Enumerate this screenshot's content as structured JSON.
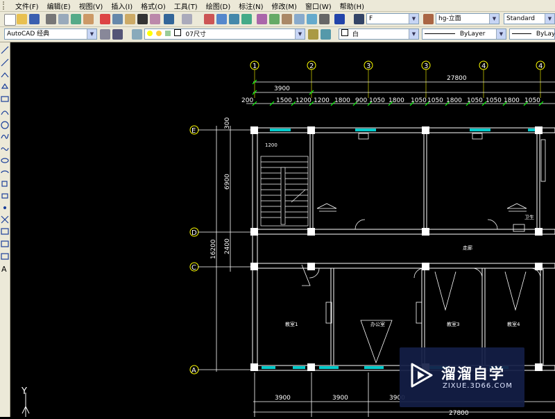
{
  "menu": [
    "文件(F)",
    "编辑(E)",
    "视图(V)",
    "插入(I)",
    "格式(O)",
    "工具(T)",
    "绘图(D)",
    "标注(N)",
    "修改(M)",
    "窗口(W)",
    "帮助(H)"
  ],
  "toolbar": {
    "text_style_combo": "F",
    "dim_style_combo": "hg-立面",
    "table_style_combo": "Standard",
    "workspace_combo": "AutoCAD 经典",
    "layer_combo": "07尺寸",
    "color_combo": "白",
    "linetype_combo": "ByLayer",
    "lineweight_combo": "ByLayer"
  },
  "drawing": {
    "grid_top": [
      "1",
      "2",
      "3",
      "3",
      "4",
      "4"
    ],
    "grid_left": [
      "E",
      "D",
      "C",
      "A"
    ],
    "dims_top_total": "27800",
    "dims_top_bay": "3900",
    "dims_top_detail": [
      "200",
      "1500",
      "1200",
      "1200",
      "1800",
      "900",
      "1050",
      "1800",
      "1050",
      "1050",
      "1800",
      "1050",
      "1050",
      "1800",
      "1050"
    ],
    "dims_left": [
      "300",
      "6900",
      "16200",
      "2400"
    ],
    "dims_bottom": [
      "3900",
      "3900",
      "3900"
    ],
    "dims_bottom_total": "27800",
    "note_1200": "1200",
    "room_tags": [
      "卫生",
      "楼梯",
      "走廊",
      "教室1",
      "办公室",
      "教室3",
      "教室4"
    ]
  },
  "watermark": {
    "title": "溜溜自学",
    "url": "ZIXUE.3D66.COM"
  },
  "ucs_label": "Y"
}
